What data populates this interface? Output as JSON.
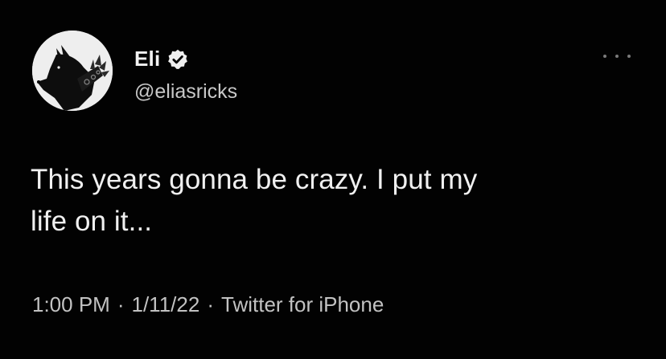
{
  "author": {
    "display_name": "Eli",
    "handle": "@eliasricks",
    "avatar_icon": "wolf-head-avatar",
    "verified_icon": "verified-badge-icon"
  },
  "tweet": {
    "text_line_1": "This years gonna be crazy. I put my",
    "text_line_2": "life on it..."
  },
  "meta": {
    "time": "1:00 PM",
    "separator": "·",
    "date": "1/11/22",
    "source": "Twitter for iPhone"
  },
  "menu": {
    "icon": "more-options-icon"
  },
  "colors": {
    "background": "#020202",
    "text_primary": "#f0f0f0",
    "text_secondary": "#c2c2c2",
    "avatar_bg": "#eeeeee"
  }
}
